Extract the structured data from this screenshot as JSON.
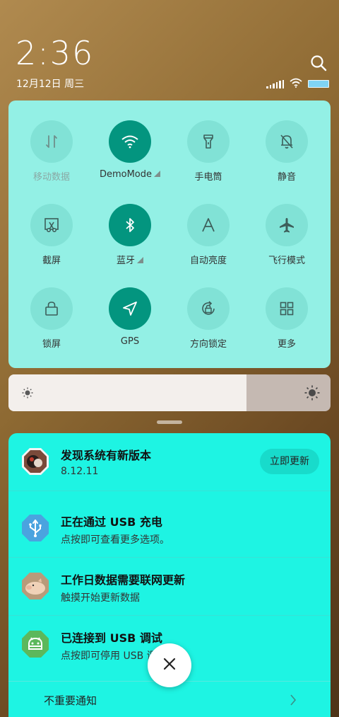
{
  "status": {
    "time": "2:36",
    "date": "12月12日 周三"
  },
  "quick_tiles": [
    {
      "label": "移动数据",
      "icon": "mobile-data-icon",
      "active": false,
      "disabled": true
    },
    {
      "label": "DemoMode",
      "icon": "wifi-icon",
      "active": true,
      "has_menu": true
    },
    {
      "label": "手电筒",
      "icon": "flashlight-icon",
      "active": false
    },
    {
      "label": "静音",
      "icon": "mute-icon",
      "active": false
    },
    {
      "label": "截屏",
      "icon": "screenshot-icon",
      "active": false
    },
    {
      "label": "蓝牙",
      "icon": "bluetooth-icon",
      "active": true,
      "has_menu": true
    },
    {
      "label": "自动亮度",
      "icon": "auto-brightness-icon",
      "active": false
    },
    {
      "label": "飞行模式",
      "icon": "airplane-icon",
      "active": false
    },
    {
      "label": "锁屏",
      "icon": "lock-icon",
      "active": false
    },
    {
      "label": "GPS",
      "icon": "gps-icon",
      "active": true
    },
    {
      "label": "方向锁定",
      "icon": "rotation-lock-icon",
      "active": false
    },
    {
      "label": "更多",
      "icon": "grid-icon",
      "active": false
    }
  ],
  "brightness": {
    "level": 0.74
  },
  "notifications": [
    {
      "title": "发现系统有新版本",
      "subtitle": "8.12.11",
      "icon": "update-app-avatar",
      "action": "立即更新"
    },
    {
      "title": "正在通过 USB 充电",
      "subtitle": "点按即可查看更多选项。",
      "icon": "usb-icon"
    },
    {
      "title": "工作日数据需要联网更新",
      "subtitle": "触摸开始更新数据",
      "icon": "pig-avatar"
    },
    {
      "title": "已连接到 USB 调试",
      "subtitle": "点按即可停用 USB 调试功能。",
      "icon": "android-debug-icon"
    }
  ],
  "minor_notifications": {
    "label": "不重要通知"
  },
  "colors": {
    "accent": "#03957f",
    "panel": "#93f0e5",
    "notif_bg": "#1ef4e3"
  }
}
